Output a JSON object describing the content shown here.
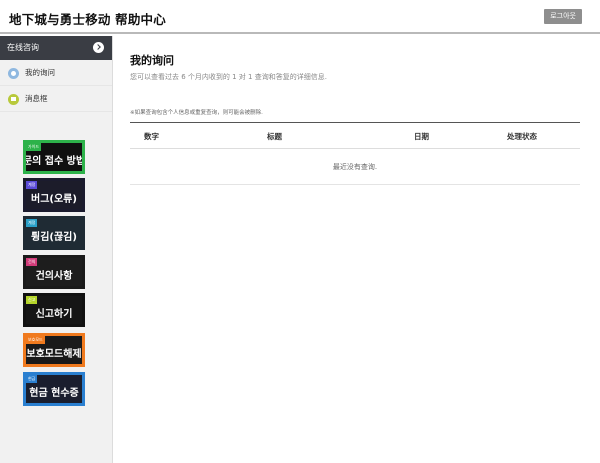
{
  "header": {
    "title": "地下城与勇士移动 帮助中心",
    "logout_label": "로그아웃"
  },
  "sidebar": {
    "section_title": "在线咨询",
    "items": [
      {
        "label": "我的询问",
        "icon": "inquiry-icon"
      },
      {
        "label": "消息框",
        "icon": "message-icon"
      }
    ],
    "banners": [
      {
        "tag": "가이드",
        "label": "문의 접수 방법",
        "border": "#2db24a",
        "bg": "#101010",
        "tag_color": "#2db24a"
      },
      {
        "tag": "계정",
        "label": "버그(오류)",
        "border": "#1b1b2e",
        "bg": "#1c1c2a",
        "tag_color": "#5b4bd8"
      },
      {
        "tag": "계정",
        "label": "튕김(끊김)",
        "border": "#1f2b34",
        "bg": "#1f2b34",
        "tag_color": "#2aa0c8"
      },
      {
        "tag": "건의",
        "label": "건의사항",
        "border": "#1a1a1a",
        "bg": "#1d1d1d",
        "tag_color": "#d23c7a"
      },
      {
        "tag": "신고",
        "label": "신고하기",
        "border": "#111111",
        "bg": "#151515",
        "tag_color": "#b5d52a"
      },
      {
        "tag": "보호모드",
        "label": "보호모드해제",
        "border": "#f07a1e",
        "bg": "#1a1a1a",
        "tag_color": "#f07a1e"
      },
      {
        "tag": "현금",
        "label": "현금 현수증",
        "border": "#2a7fd0",
        "bg": "#1a1e2e",
        "tag_color": "#2a7fd0"
      }
    ]
  },
  "main": {
    "title": "我的询问",
    "description": "您可以查看过去 6 个月内收到的 1 对 1 查询和答复的详细信息.",
    "notice": "※如果查询包含个人信息或重复查询，则可能会被删除.",
    "table": {
      "columns": [
        "数字",
        "标题",
        "日期",
        "处理状态"
      ],
      "empty_text": "最近没有查询."
    }
  }
}
